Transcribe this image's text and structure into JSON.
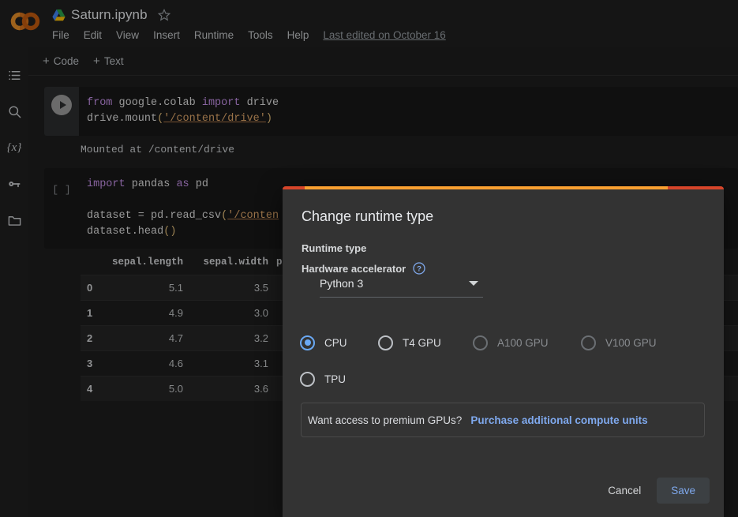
{
  "app": {
    "logo_alt": "colab-logo",
    "doc_title": "Saturn.ipynb",
    "last_edited": "Last edited on October 16"
  },
  "menubar": {
    "items": [
      {
        "label": "File"
      },
      {
        "label": "Edit"
      },
      {
        "label": "View"
      },
      {
        "label": "Insert"
      },
      {
        "label": "Runtime"
      },
      {
        "label": "Tools"
      },
      {
        "label": "Help"
      }
    ]
  },
  "rail": {
    "items": [
      {
        "name": "table-of-contents-icon"
      },
      {
        "name": "search-icon"
      },
      {
        "name": "variables-icon",
        "glyph": "{x}"
      },
      {
        "name": "secrets-key-icon"
      },
      {
        "name": "files-folder-icon"
      }
    ]
  },
  "toolbar": {
    "add_code_label": "Code",
    "add_text_label": "Text",
    "plus": "+"
  },
  "cells": [
    {
      "type": "code",
      "prompt": "run",
      "lines": [
        [
          {
            "t": "from ",
            "c": "kw"
          },
          {
            "t": "google.colab ",
            "c": "plain"
          },
          {
            "t": "import ",
            "c": "kw"
          },
          {
            "t": "drive",
            "c": "plain"
          }
        ],
        [
          {
            "t": "drive.mount",
            "c": "plain"
          },
          {
            "t": "(",
            "c": "paren"
          },
          {
            "t": "'/content/drive'",
            "c": "str"
          },
          {
            "t": ")",
            "c": "paren"
          }
        ]
      ],
      "output": "Mounted at /content/drive"
    },
    {
      "type": "code",
      "prompt": "[ ]",
      "lines": [
        [
          {
            "t": "import ",
            "c": "kw"
          },
          {
            "t": "pandas ",
            "c": "plain"
          },
          {
            "t": "as ",
            "c": "kw"
          },
          {
            "t": "pd",
            "c": "plain"
          }
        ],
        [
          {
            "t": "",
            "c": "plain"
          }
        ],
        [
          {
            "t": "dataset = pd.read_csv",
            "c": "plain"
          },
          {
            "t": "(",
            "c": "paren"
          },
          {
            "t": "'/conten",
            "c": "str"
          }
        ],
        [
          {
            "t": "dataset.head",
            "c": "plain"
          },
          {
            "t": "()",
            "c": "paren"
          }
        ]
      ]
    }
  ],
  "dataframe": {
    "columns": [
      "sepal.length",
      "sepal.width",
      "p"
    ],
    "rows": [
      {
        "index": "0",
        "values": [
          "5.1",
          "3.5"
        ]
      },
      {
        "index": "1",
        "values": [
          "4.9",
          "3.0"
        ]
      },
      {
        "index": "2",
        "values": [
          "4.7",
          "3.2"
        ]
      },
      {
        "index": "3",
        "values": [
          "4.6",
          "3.1"
        ]
      },
      {
        "index": "4",
        "values": [
          "5.0",
          "3.6"
        ]
      }
    ]
  },
  "dialog": {
    "title": "Change runtime type",
    "runtime_type_label": "Runtime type",
    "runtime_type_value": "Python 3",
    "hardware_accelerator_label": "Hardware accelerator",
    "help_icon_glyph": "?",
    "accelerators": [
      {
        "label": "CPU",
        "selected": true,
        "disabled": false
      },
      {
        "label": "T4 GPU",
        "selected": false,
        "disabled": false
      },
      {
        "label": "A100 GPU",
        "selected": false,
        "disabled": true
      },
      {
        "label": "V100 GPU",
        "selected": false,
        "disabled": true
      },
      {
        "label": "TPU",
        "selected": false,
        "disabled": false
      }
    ],
    "premium_prompt": "Want access to premium GPUs?",
    "premium_link": "Purchase additional compute units",
    "cancel_label": "Cancel",
    "save_label": "Save"
  },
  "colors": {
    "accent_blue": "#7fa9ee",
    "progress_bright": "#f9a031",
    "progress_dark": "#d6452a",
    "dialog_bg": "#333333",
    "page_bg": "#1e1e1e"
  }
}
